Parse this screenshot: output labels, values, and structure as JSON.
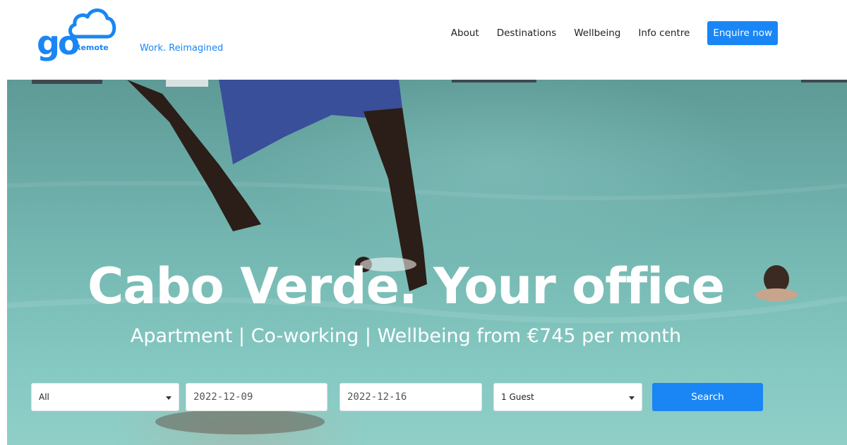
{
  "brand": {
    "logo_main": "go",
    "logo_sub": "Remote",
    "tagline": "Work. Reimagined",
    "color": "#1a86f5"
  },
  "nav": {
    "items": [
      {
        "label": "About"
      },
      {
        "label": "Destinations"
      },
      {
        "label": "Wellbeing"
      },
      {
        "label": "Info centre"
      }
    ],
    "cta": "Enquire now"
  },
  "hero": {
    "title": "Cabo Verde. Your office",
    "subtitle": "Apartment | Co-working | Wellbeing from €745 per month"
  },
  "search": {
    "destination": "All",
    "check_in": "2022-12-09",
    "check_out": "2022-12-16",
    "guests": "1 Guest",
    "button": "Search"
  }
}
